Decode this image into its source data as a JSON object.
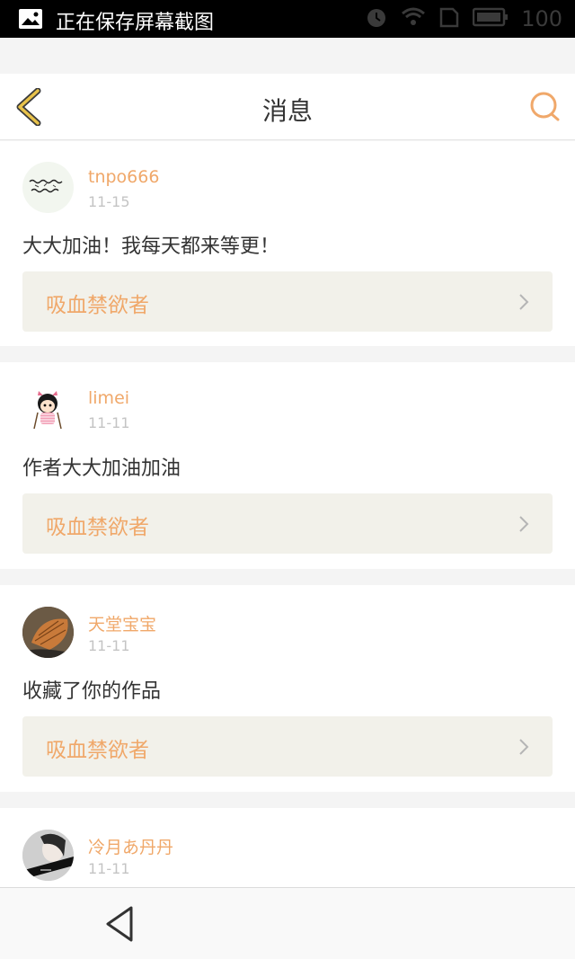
{
  "status_bar": {
    "notification_text": "正在保存屏幕截图",
    "battery_level": "100",
    "icons": [
      "image-icon",
      "alarm-icon",
      "wifi-icon",
      "sim-icon",
      "battery-icon"
    ]
  },
  "header": {
    "title": "消息",
    "back_icon": "chevron-left-icon",
    "search_icon": "search-icon",
    "accent_color": "#f0a86a",
    "back_color": "#e8c24a"
  },
  "messages": [
    {
      "username": "tnpo666",
      "date": "11-15",
      "text": "大大加油！我每天都来等更！",
      "work_title": "吸血禁欲者"
    },
    {
      "username": "limei",
      "date": "11-11",
      "text": "作者大大加油加油",
      "work_title": "吸血禁欲者"
    },
    {
      "username": "天堂宝宝",
      "date": "11-11",
      "text": "收藏了你的作品",
      "work_title": "吸血禁欲者"
    },
    {
      "username": "冷月あ丹丹",
      "date": "11-11"
    }
  ],
  "navbar": {
    "back_icon": "triangle-back-icon"
  }
}
